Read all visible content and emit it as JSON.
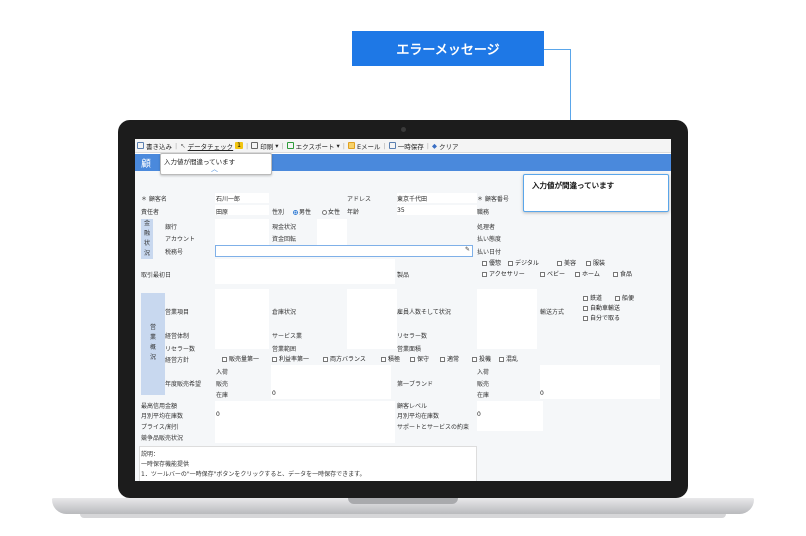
{
  "callout": {
    "title": "エラーメッセージ",
    "message": "入力値が間違っています"
  },
  "toolbar": {
    "write": "書き込み",
    "datacheck": "データチェック",
    "datacheck_count": "1",
    "print": "印刷",
    "export": "エクスポート",
    "email": "Eメール",
    "tempsave": "一時保存",
    "clear": "クリア"
  },
  "header": {
    "title_fragment": "顧",
    "tooltip": "入力値が間違っています"
  },
  "form": {
    "customer_name_label": "＊ 顧客名",
    "customer_name_value": "石川一郎",
    "address_label": "アドレス",
    "address_value": "東京千代田",
    "customer_no_label": "＊ 顧客番号",
    "owner_label": "責任者",
    "owner_value": "田原",
    "gender_label": "性別",
    "gender_male": "男性",
    "gender_female": "女性",
    "age_label": "年齢",
    "age_value": "35",
    "position_label": "職務",
    "finance_side": [
      "金",
      "融",
      "状",
      "況"
    ],
    "bank_label": "銀行",
    "account_label": "アカウント",
    "taxno_label": "税務号",
    "cash_label": "現金状況",
    "funds_label": "資金回転",
    "handler_label": "処理者",
    "payment_label": "払い態度",
    "paydate_label": "払い日付",
    "first_trade_label": "取引最初日",
    "product_label": "製品",
    "product_options": [
      "優惣",
      "デジタル",
      "美容",
      "服装",
      "アクセサリー",
      "ベビー",
      "ホーム",
      "食品"
    ],
    "business_side": [
      "営",
      "業",
      "概",
      "況"
    ],
    "sales_items_label": "営業項目",
    "warehouse_label": "倉庫状況",
    "employees_label": "雇員人数そして状況",
    "shipping_label": "輸送方式",
    "shipping_options": [
      "鉄道",
      "船便",
      "自動車輸送",
      "自分で取る"
    ],
    "system_label": "経営体制",
    "service_label": "サービス業",
    "reseller_count_label": "リセラー数",
    "reseller_label": "リセラー数",
    "business_scope_label": "営業範囲",
    "business_area_label": "営業面積",
    "policy_label": "経営方針",
    "policy_options": [
      "販売量第一",
      "利益率第一",
      "両方バランス",
      "積極",
      "保守",
      "適常",
      "投機",
      "混乱"
    ],
    "annual_sales_label": "年度販売希望",
    "in_label": "入荷",
    "sales_label": "販売",
    "stock_label": "在庫",
    "stock_value": "0",
    "first_brand_label": "第一ブランド",
    "in_label2": "入荷",
    "sales_label2": "販売",
    "stock_label2": "在庫",
    "stock_value2": "0",
    "max_credit_label": "最高信用金額",
    "customer_level_label": "顧客レベル",
    "monthly_stock_label": "月別平均在庫数",
    "monthly_stock_value": "0",
    "monthly_stock_label2": "月別平均在庫数",
    "monthly_stock_value2": "0",
    "price_label": "プライス/割引",
    "support_label": "サポートとサービスの約束",
    "competitor_label": "競争品販売状況",
    "note_title": "説明：",
    "note_line1": "一時保存機能提供",
    "note_line2": "1．ツールバーの\"一時保存\"ボタンをクリックすると、データを一時保存できます。"
  }
}
